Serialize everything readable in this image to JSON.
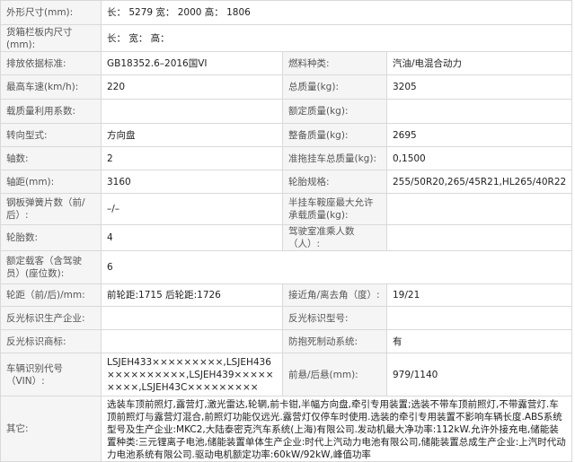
{
  "rows": [
    {
      "type": "full",
      "label": "外形尺寸(mm):",
      "value": "长： 5279 宽： 2000 高： 1806"
    },
    {
      "type": "full",
      "label": "货箱栏板内尺寸(mm):",
      "value": "长：  宽：  高："
    },
    {
      "type": "pair",
      "label1": "排放依据标准:",
      "value1": "GB18352.6–2016国VI",
      "label2": "燃料种类:",
      "value2": "汽油/电混合动力"
    },
    {
      "type": "pair",
      "label1": "最高车速(km/h):",
      "value1": "220",
      "label2": "总质量(kg):",
      "value2": "3205"
    },
    {
      "type": "pair",
      "label1": "载质量利用系数:",
      "value1": "",
      "label2": "额定质量(kg):",
      "value2": ""
    },
    {
      "type": "pair",
      "label1": "转向型式:",
      "value1": "方向盘",
      "label2": "整备质量(kg):",
      "value2": "2695"
    },
    {
      "type": "pair",
      "label1": "轴数:",
      "value1": "2",
      "label2": "准拖挂车总质量(kg):",
      "value2": "0,1500"
    },
    {
      "type": "pair",
      "label1": "轴距(mm):",
      "value1": "3160",
      "label2": "轮胎规格:",
      "value2": "255/50R20,265/45R21,HL265/40R22"
    },
    {
      "type": "pair",
      "label1": "钢板弹簧片数（前/后）:",
      "value1": "–/–",
      "label2": "半挂车鞍座最大允许承载质量(kg):",
      "value2": ""
    },
    {
      "type": "pair",
      "label1": "轮胎数:",
      "value1": "4",
      "label2": "驾驶室准乘人数（人）:",
      "value2": ""
    },
    {
      "type": "full",
      "label": "额定载客（含驾驶员）(座位数):",
      "value": "6"
    },
    {
      "type": "pair",
      "label1": "轮距（前/后)/mm:",
      "value1": "前轮距:1715 后轮距:1726",
      "label2": "接近角/离去角（度）:",
      "value2": "19/21"
    },
    {
      "type": "pair",
      "label1": "反光标识生产企业:",
      "value1": "",
      "label2": "反光标识型号:",
      "value2": ""
    },
    {
      "type": "pair",
      "label1": "反光标识商标:",
      "value1": "",
      "label2": "防抱死制动系统:",
      "value2": "有"
    },
    {
      "type": "pair",
      "label1": "车辆识别代号（VIN）:",
      "value1": "LSJEH433×××××××××,LSJEH436××××××××××,LSJEH439×××××××××,LSJEH43C×××××××××",
      "label2": "前悬/后悬(mm):",
      "value2": "979/1140"
    },
    {
      "type": "other",
      "label": "其它:",
      "value": "选装车顶前照灯,露营灯,激光雷达,轮辋,前卡钳,半幅方向盘,牵引专用装置;选装不带车顶前照灯,不带露营灯.车顶前照灯与露营灯混合,前照灯功能仅远光.露营灯仅停车时使用.选装的牵引专用装置不影响车辆长度.ABS系统型号及生产企业:MKC2,大陆泰密克汽车系统(上海)有限公司.发动机最大净功率:112kW.允许外接充电,储能装置种类:三元锂离子电池,储能装置单体生产企业:时代上汽动力电池有限公司,储能装置总成生产企业:上汽时代动力电池系统有限公司.驱动电机额定功率:60kW/92kW,峰值功率"
    }
  ]
}
